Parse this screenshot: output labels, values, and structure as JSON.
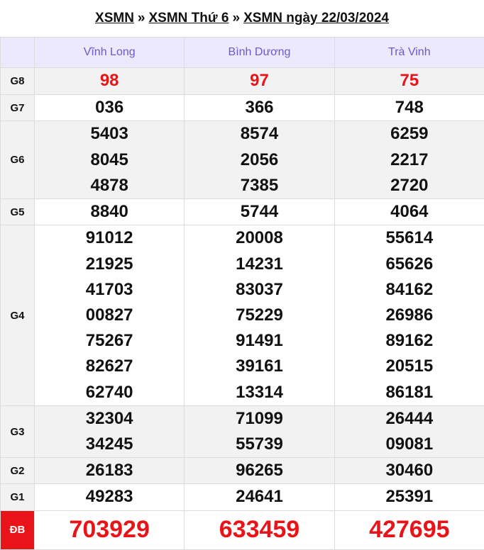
{
  "breadcrumb": {
    "link1": "XSMN",
    "sep1": "»",
    "link2": "XSMN Thứ 6",
    "sep2": "»",
    "link3": "XSMN ngày 22/03/2024"
  },
  "provinces": [
    "Vĩnh Long",
    "Bình Dương",
    "Trà Vinh"
  ],
  "prizes": [
    {
      "label": "G8",
      "values": [
        [
          "98"
        ],
        [
          "97"
        ],
        [
          "75"
        ]
      ]
    },
    {
      "label": "G7",
      "values": [
        [
          "036"
        ],
        [
          "366"
        ],
        [
          "748"
        ]
      ]
    },
    {
      "label": "G6",
      "values": [
        [
          "5403",
          "8045",
          "4878"
        ],
        [
          "8574",
          "2056",
          "7385"
        ],
        [
          "6259",
          "2217",
          "2720"
        ]
      ]
    },
    {
      "label": "G5",
      "values": [
        [
          "8840"
        ],
        [
          "5744"
        ],
        [
          "4064"
        ]
      ]
    },
    {
      "label": "G4",
      "values": [
        [
          "91012",
          "21925",
          "41703",
          "00827",
          "75267",
          "82627",
          "62740"
        ],
        [
          "20008",
          "14231",
          "83037",
          "75229",
          "91491",
          "39161",
          "13314"
        ],
        [
          "55614",
          "65626",
          "84162",
          "26986",
          "89162",
          "20515",
          "86181"
        ]
      ]
    },
    {
      "label": "G3",
      "values": [
        [
          "32304",
          "34245"
        ],
        [
          "71099",
          "55739"
        ],
        [
          "26444",
          "09081"
        ]
      ]
    },
    {
      "label": "G2",
      "values": [
        [
          "26183"
        ],
        [
          "96265"
        ],
        [
          "30460"
        ]
      ]
    },
    {
      "label": "G1",
      "values": [
        [
          "49283"
        ],
        [
          "24641"
        ],
        [
          "25391"
        ]
      ]
    },
    {
      "label": "ĐB",
      "values": [
        [
          "703929"
        ],
        [
          "633459"
        ],
        [
          "427695"
        ]
      ]
    }
  ],
  "colors": {
    "header_bg": "#ebe9fb",
    "header_text": "#6a5acd",
    "accent_red": "#e8141a",
    "row_alt": "#f2f2f2"
  }
}
